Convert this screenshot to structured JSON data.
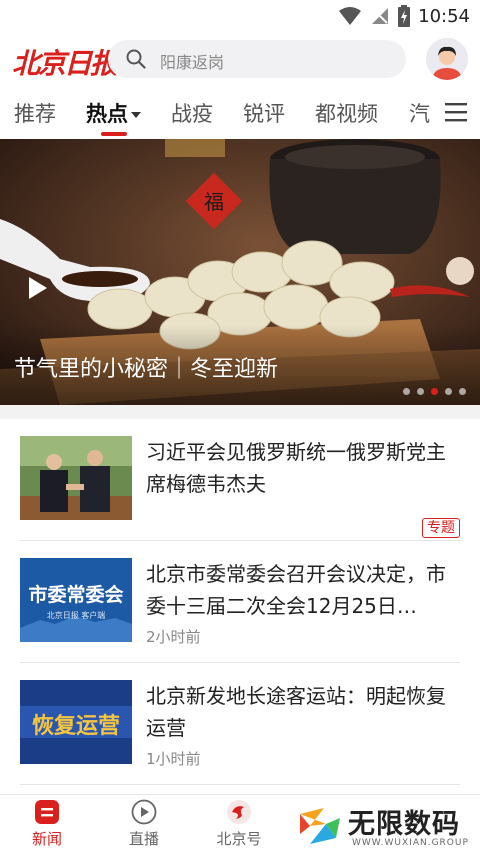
{
  "status_bar": {
    "time": "10:54"
  },
  "header": {
    "logo": "北京日报",
    "search_placeholder": "阳康返岗"
  },
  "tabs": [
    {
      "label": "推荐"
    },
    {
      "label": "热点",
      "active": true
    },
    {
      "label": "战疫"
    },
    {
      "label": "锐评"
    },
    {
      "label": "都视频"
    },
    {
      "label": "汽"
    }
  ],
  "banner": {
    "title": "节气里的小秘密｜冬至迎新",
    "dot_count": 5,
    "active_dot": 3
  },
  "news": [
    {
      "title": "习近平会见俄罗斯统一俄罗斯党主席梅德韦杰夫",
      "badge": "专题",
      "time": ""
    },
    {
      "title": "北京市委常委会召开会议决定，市委十三届二次全会12月25日…",
      "thumb_text": "市委常委会",
      "thumb_sub": "北京日报 客户端",
      "time": "2小时前"
    },
    {
      "title": "北京新发地长途客运站：明起恢复运营",
      "thumb_text": "恢复运营",
      "time": "1小时前"
    }
  ],
  "bottom_nav": [
    {
      "label": "新闻",
      "active": true
    },
    {
      "label": "直播"
    },
    {
      "label": "北京号"
    }
  ],
  "watermark": {
    "text": "无限数码",
    "sub": "WWW.WUXIAN.GROUP"
  },
  "colors": {
    "accent": "#d9201c"
  }
}
